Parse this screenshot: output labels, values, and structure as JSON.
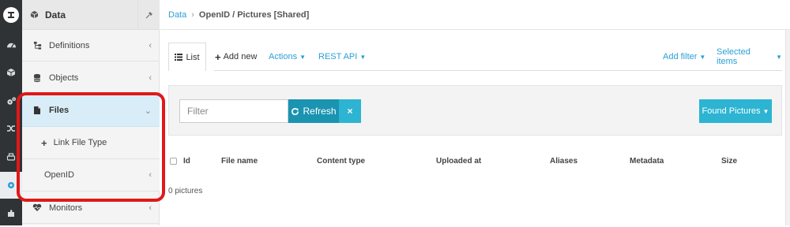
{
  "rail": {
    "items": [
      {
        "icon": "app-logo-icon"
      },
      {
        "icon": "dashboard-icon"
      },
      {
        "icon": "cube-icon"
      },
      {
        "icon": "cogs-icon"
      },
      {
        "icon": "shuffle-icon"
      },
      {
        "icon": "printer-icon"
      },
      {
        "icon": "gear-icon"
      },
      {
        "icon": "puzzle-icon"
      }
    ]
  },
  "sidebar": {
    "title": "Data",
    "items": [
      {
        "label": "Definitions",
        "icon": "sitemap-icon"
      },
      {
        "label": "Objects",
        "icon": "database-icon"
      },
      {
        "label": "Files",
        "icon": "file-icon"
      },
      {
        "label": "Link File Type",
        "icon": "plus-icon"
      },
      {
        "label": "OpenID"
      },
      {
        "label": "Monitors",
        "icon": "heartbeat-icon"
      }
    ]
  },
  "breadcrumb": {
    "root": "Data",
    "separator": "›",
    "current": "OpenID / Pictures [Shared]"
  },
  "toolbar": {
    "list_label": "List",
    "add_label": "Add new",
    "actions_label": "Actions",
    "rest_label": "REST API",
    "add_filter_label": "Add filter",
    "selected_items_label": "Selected items"
  },
  "filter": {
    "placeholder": "Filter",
    "refresh_label": "Refresh",
    "clear_label": "×",
    "found_label": "Found Pictures"
  },
  "table": {
    "columns": [
      "Id",
      "File name",
      "Content type",
      "Uploaded at",
      "Aliases",
      "Metadata",
      "Size"
    ],
    "empty_text": "0 pictures"
  },
  "colors": {
    "accent": "#2a9fd6",
    "button_dark": "#1a94b0",
    "button_light": "#2cb4d2",
    "highlight": "#e01818",
    "active_item_bg": "#d8edf7"
  }
}
